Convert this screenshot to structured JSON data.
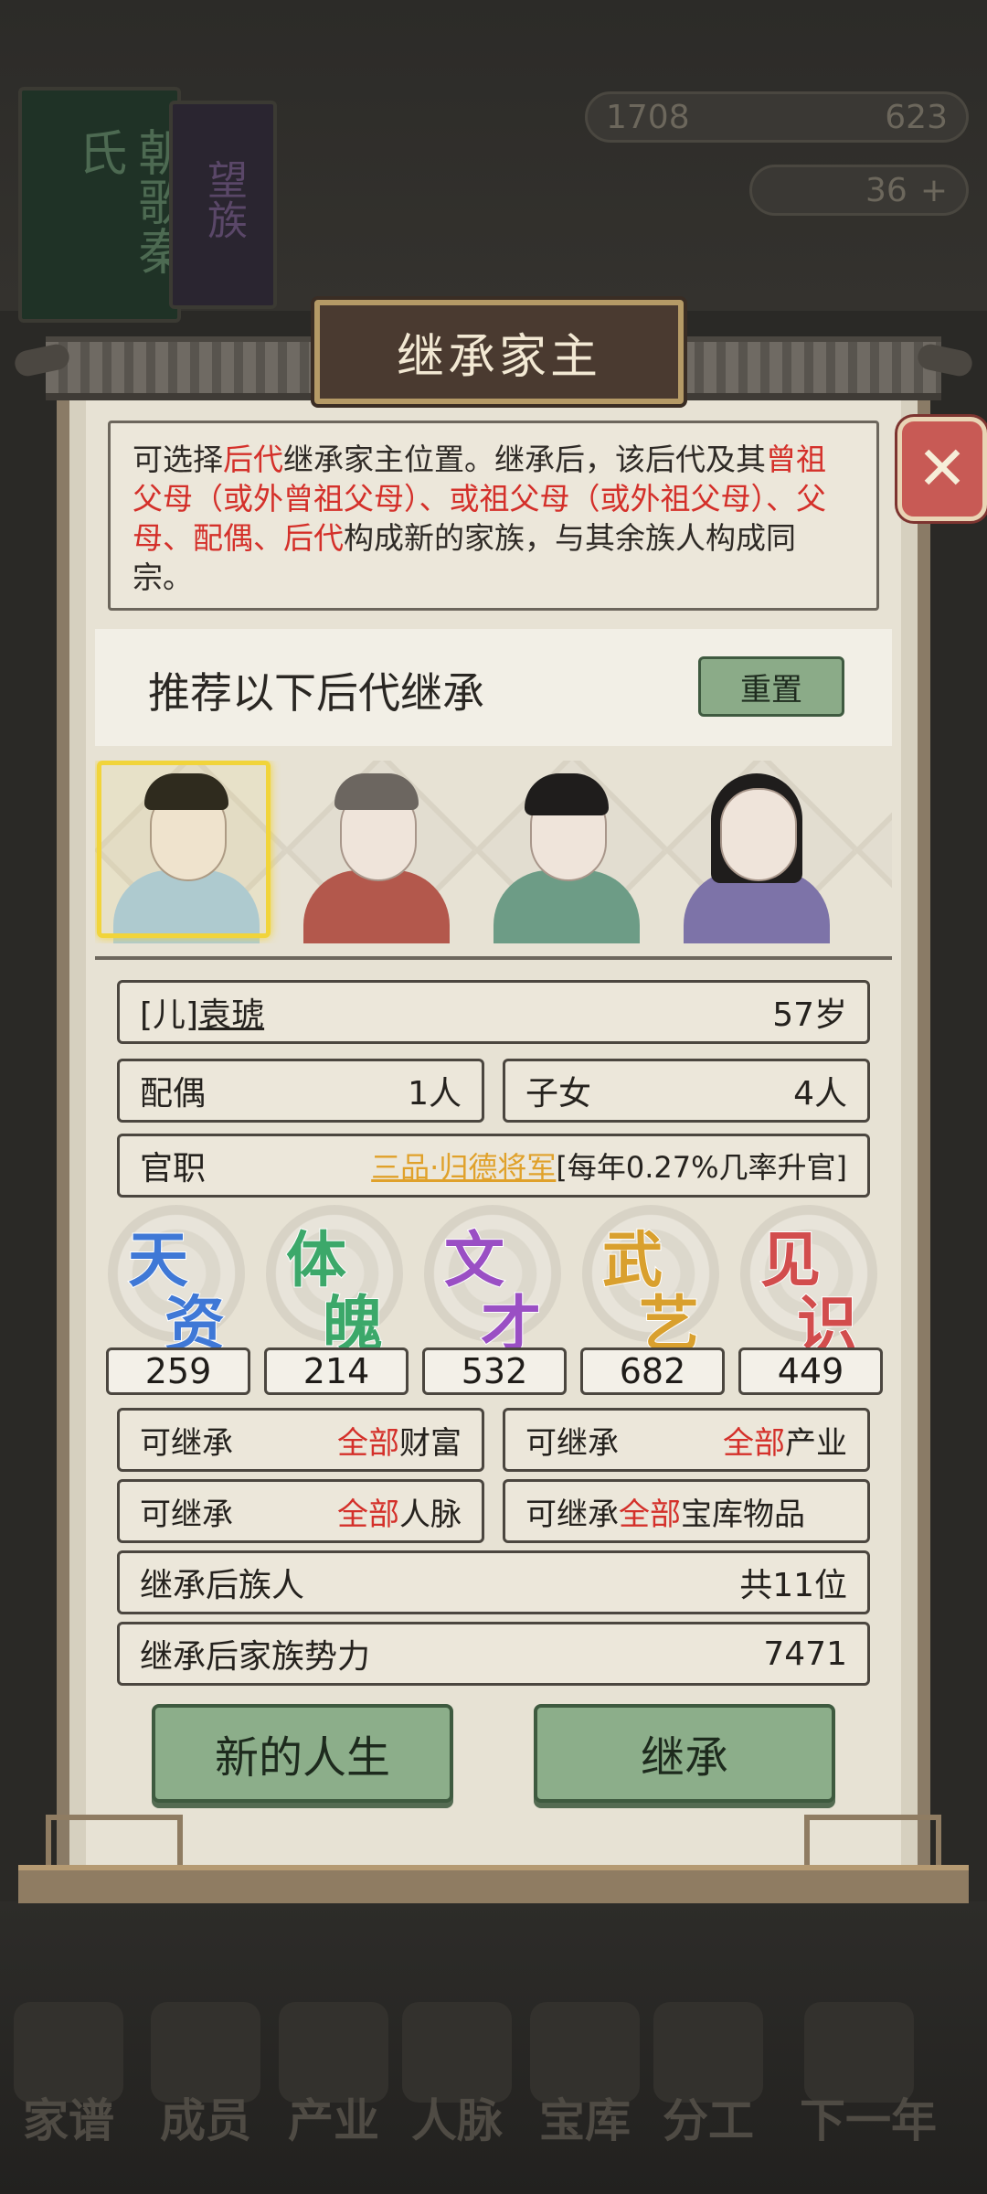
{
  "background": {
    "book_title": "朝歌秦氏",
    "book_sub": "望族",
    "resources": [
      "1708",
      "623"
    ],
    "gold": "36",
    "nav": [
      "家谱",
      "成员",
      "产业",
      "人脉",
      "宝库",
      "分工",
      "下一年"
    ]
  },
  "dialog": {
    "title": "继承家主",
    "close_icon": "close-x-icon",
    "description": {
      "p1": "可选择",
      "r1": "后代",
      "p2": "继承家主位置。继承后，该后代及其",
      "r2": "曾祖父母（或外曾祖父母）、或祖父母（或外祖父母）、父母、配偶、后代",
      "p3": "构成新的家族，与其余族人构成同宗。"
    },
    "recommend_title": "推荐以下后代继承",
    "reset_label": "重置",
    "candidates": [
      {
        "name": "son-portrait",
        "selected": true,
        "robe": "#a9c9dc"
      },
      {
        "name": "elder-woman-portrait",
        "selected": false,
        "robe": "#b3584c"
      },
      {
        "name": "girl-portrait",
        "selected": false,
        "robe": "#6d9c86"
      },
      {
        "name": "long-hair-man-portrait",
        "selected": false,
        "robe": "#7d73a8"
      }
    ],
    "person": {
      "relation": "[儿]",
      "name": "袁琥",
      "age": "57岁",
      "spouse_label": "配偶",
      "spouse_value": "1人",
      "children_label": "子女",
      "children_value": "4人",
      "office_label": "官职",
      "office_value": "三品·归德将军",
      "office_note": "[每年0.27%几率升官]"
    },
    "stats": [
      {
        "top": "天",
        "bottom": "资",
        "value": "259",
        "color": "#3f78d6"
      },
      {
        "top": "体",
        "bottom": "魄",
        "value": "214",
        "color": "#3ca86a"
      },
      {
        "top": "文",
        "bottom": "才",
        "value": "532",
        "color": "#9a4fc4"
      },
      {
        "top": "武",
        "bottom": "艺",
        "value": "682",
        "color": "#d9a02e"
      },
      {
        "top": "见",
        "bottom": "识",
        "value": "449",
        "color": "#d24d4d"
      }
    ],
    "inherit": {
      "wealth": {
        "prefix": "可继承",
        "highlight": "全部",
        "suffix": "财富"
      },
      "industry": {
        "prefix": "可继承",
        "highlight": "全部",
        "suffix": "产业"
      },
      "network": {
        "prefix": "可继承",
        "highlight": "全部",
        "suffix": "人脉"
      },
      "treasury": {
        "prefix": "可继承",
        "highlight": "全部",
        "suffix": "宝库物品"
      },
      "members_label": "继承后族人",
      "members_value": "共11位",
      "power_label": "继承后家族势力",
      "power_value": "7471"
    },
    "new_life_label": "新的人生",
    "inherit_label": "继承"
  }
}
